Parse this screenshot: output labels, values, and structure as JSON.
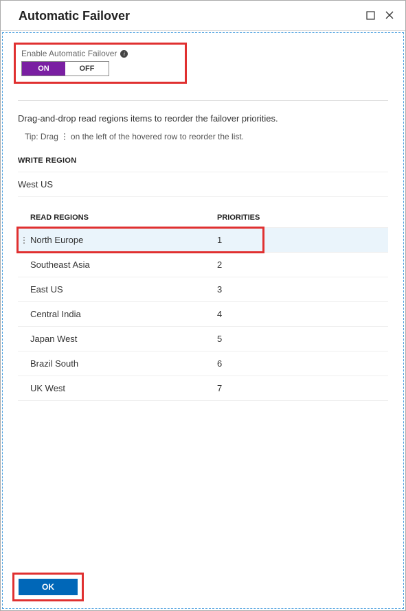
{
  "header": {
    "title": "Automatic Failover"
  },
  "toggle": {
    "label": "Enable Automatic Failover",
    "on_label": "ON",
    "off_label": "OFF"
  },
  "instruction": "Drag-and-drop read regions items to reorder the failover priorities.",
  "tip_prefix": "Tip: Drag",
  "tip_suffix": "on the left of the hovered row to reorder the list.",
  "write_region": {
    "heading": "WRITE REGION",
    "value": "West US"
  },
  "read_regions": {
    "heading_name": "READ REGIONS",
    "heading_priority": "PRIORITIES",
    "rows": [
      {
        "name": "North Europe",
        "priority": "1",
        "highlighted": true
      },
      {
        "name": "Southeast Asia",
        "priority": "2",
        "highlighted": false
      },
      {
        "name": "East US",
        "priority": "3",
        "highlighted": false
      },
      {
        "name": "Central India",
        "priority": "4",
        "highlighted": false
      },
      {
        "name": "Japan West",
        "priority": "5",
        "highlighted": false
      },
      {
        "name": "Brazil South",
        "priority": "6",
        "highlighted": false
      },
      {
        "name": "UK West",
        "priority": "7",
        "highlighted": false
      }
    ]
  },
  "footer": {
    "ok_label": "OK"
  }
}
